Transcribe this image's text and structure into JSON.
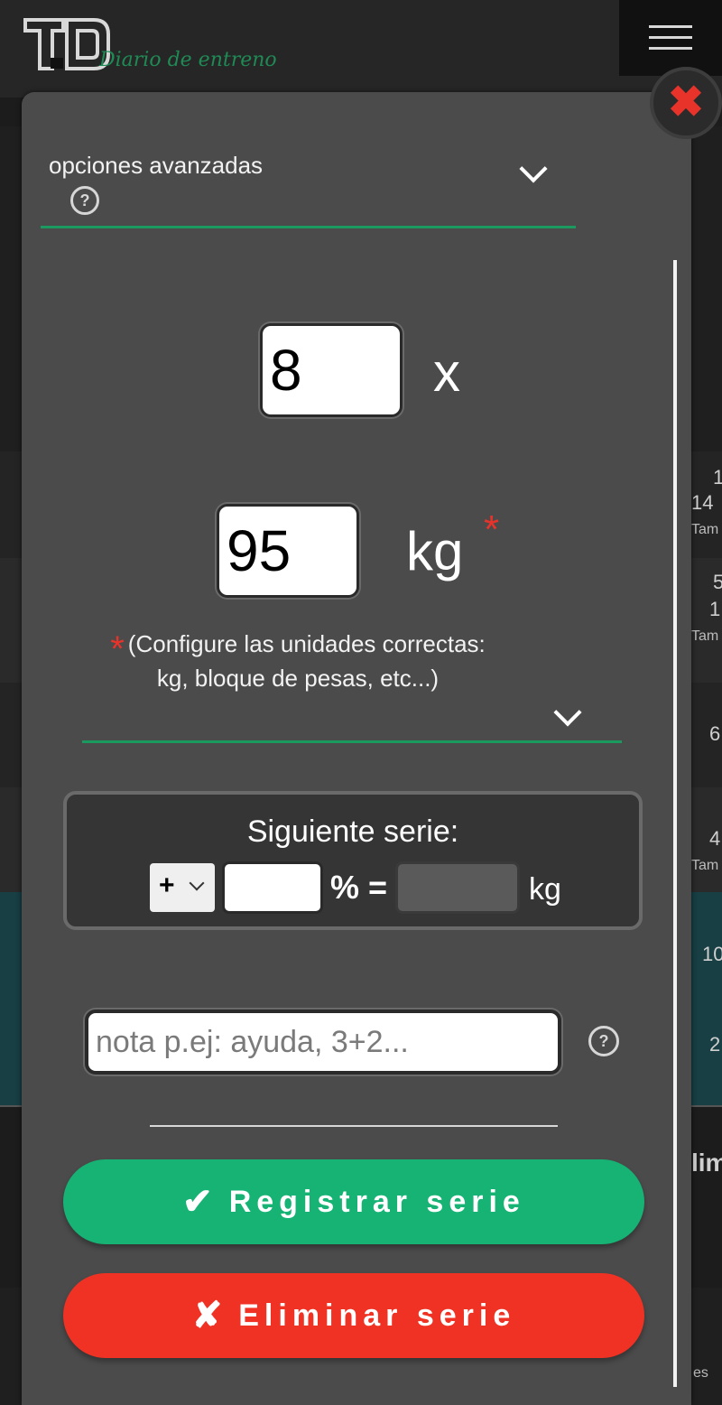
{
  "header": {
    "logo_text": "TD",
    "tagline": "Diario de entreno"
  },
  "background": {
    "rows": [
      {
        "line1": "1",
        "line2": "14",
        "line3": "Tam"
      },
      {
        "line1": "5",
        "line2": "1",
        "line3": "Tam"
      },
      {
        "line1": "6",
        "line2": "",
        "line3": ""
      },
      {
        "line1": "4",
        "line2": "",
        "line3": "Tam"
      },
      {
        "line1": "10",
        "line2": "",
        "line3": ""
      },
      {
        "line1": "2",
        "line2": "",
        "line3": ""
      },
      {
        "line1": "lim",
        "line2": "",
        "line3": ""
      },
      {
        "line1": "es",
        "line2": "",
        "line3": ""
      }
    ]
  },
  "modal": {
    "advanced_options_label": "opciones avanzadas",
    "reps_value": "8",
    "reps_multiplier": "x",
    "weight_value": "95",
    "weight_unit": "kg",
    "required_mark": "*",
    "units_note": "(Configure las unidades correctas: kg, bloque de pesas, etc...)",
    "next_set": {
      "title": "Siguiente serie:",
      "sign": "+",
      "percent_value": "",
      "percent_label": "% =",
      "result_value": "",
      "result_unit": "kg"
    },
    "note_placeholder": "nota p.ej: ayuda, 3+2...",
    "register_label": "Registrar serie",
    "register_icon": "✔",
    "delete_label": "Eliminar serie",
    "delete_icon": "✘",
    "close_icon": "✖",
    "help_icon": "?"
  },
  "colors": {
    "accent_green": "#16b374",
    "danger_red": "#f03224",
    "line_green": "#1b9a60"
  }
}
